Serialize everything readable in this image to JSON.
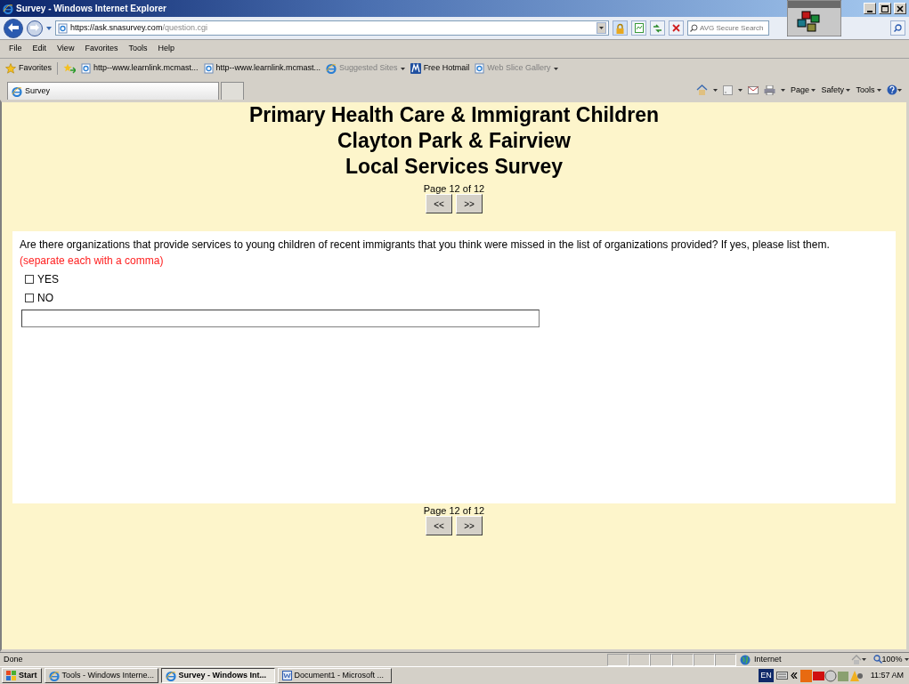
{
  "window": {
    "title": "Survey - Windows Internet Explorer"
  },
  "address": {
    "scheme": "https://",
    "host": "ask.snasurvey.com",
    "path": "/question.cgi"
  },
  "search": {
    "placeholder": "AVG Secure Search"
  },
  "menu": [
    "File",
    "Edit",
    "View",
    "Favorites",
    "Tools",
    "Help"
  ],
  "favorites_bar": {
    "label": "Favorites",
    "items": [
      {
        "label": "http--www.learnlink.mcmast...",
        "kind": "page",
        "dimmed": false,
        "dropdown": false
      },
      {
        "label": "http--www.learnlink.mcmast...",
        "kind": "page",
        "dimmed": false,
        "dropdown": false
      },
      {
        "label": "Suggested Sites",
        "kind": "ie",
        "dimmed": true,
        "dropdown": true
      },
      {
        "label": "Free Hotmail",
        "kind": "hotmail",
        "dimmed": false,
        "dropdown": false
      },
      {
        "label": "Web Slice Gallery",
        "kind": "page",
        "dimmed": true,
        "dropdown": true
      }
    ]
  },
  "tabs": [
    {
      "label": "Survey",
      "selected": true
    }
  ],
  "command_bar": [
    "Page",
    "Safety",
    "Tools"
  ],
  "page": {
    "titles": [
      "Primary Health Care & Immigrant Children",
      "Clayton Park & Fairview",
      "Local Services Survey"
    ],
    "pager_top": {
      "label": "Page 12 of 12",
      "prev": "<<",
      "next": ">>"
    },
    "question": {
      "text": "Are there organizations that provide services to young children of recent immigrants that you think were missed in the list of organizations provided? If yes, please list them.",
      "hint": "(separate each with a comma)",
      "options": [
        {
          "label": "YES",
          "checked": false
        },
        {
          "label": "NO",
          "checked": false
        }
      ]
    },
    "pager_bottom": {
      "label": "Page 12 of 12",
      "prev": "<<",
      "next": ">>"
    }
  },
  "status_bar": {
    "text": "Done",
    "zone": "Internet",
    "zoom": "100%"
  },
  "taskbar": {
    "start": "Start",
    "buttons": [
      {
        "label": "Tools - Windows Interne...",
        "kind": "ie",
        "selected": false
      },
      {
        "label": "Survey - Windows Int...",
        "kind": "ie",
        "selected": true
      },
      {
        "label": "Document1 - Microsoft ...",
        "kind": "word",
        "selected": false
      }
    ],
    "language": "EN",
    "clock": "11:57 AM"
  }
}
